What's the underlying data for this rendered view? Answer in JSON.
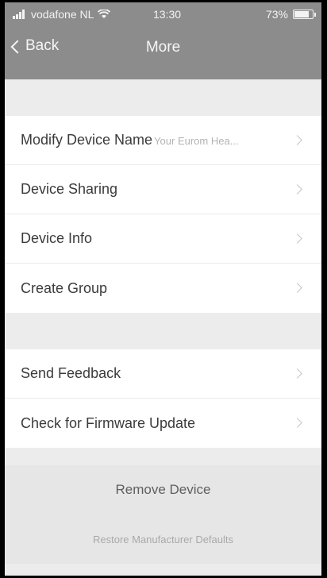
{
  "status_bar": {
    "carrier": "vodafone NL",
    "time": "13:30",
    "battery_percent": "73%",
    "battery_level": 0.73,
    "signal_icon": "signal-icon",
    "wifi_icon": "wifi-icon",
    "battery_icon": "battery-icon"
  },
  "nav": {
    "back_label": "Back",
    "title": "More"
  },
  "group1": [
    {
      "label": "Modify Device Name",
      "value": "Your Eurom Hea..."
    },
    {
      "label": "Device Sharing",
      "value": ""
    },
    {
      "label": "Device Info",
      "value": ""
    },
    {
      "label": "Create Group",
      "value": ""
    }
  ],
  "group2": [
    {
      "label": "Send Feedback"
    },
    {
      "label": "Check for Firmware Update"
    }
  ],
  "actions": {
    "remove_device": "Remove Device",
    "restore_defaults": "Restore Manufacturer Defaults"
  },
  "colors": {
    "header_bg": "#8c8c8c",
    "page_bg": "#ececec",
    "row_bg": "#ffffff",
    "text_primary": "#3b3b3b",
    "text_secondary": "#b3b3b3"
  }
}
